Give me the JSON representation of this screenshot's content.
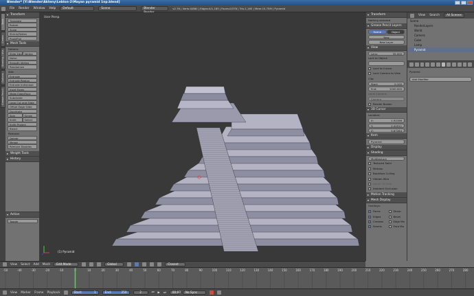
{
  "window": {
    "title": "Blender* [Y:\\Blender\\Akteny\\Leblon-2\\Mayan pyramid 1np.blend]"
  },
  "menubar": {
    "items": [
      "File",
      "Render",
      "Window",
      "Help"
    ],
    "layout": "Default",
    "scene": "Scene",
    "engine": "Blender Render",
    "stats": "v2.76 | Verts:0/880 | Edges:0/1,185 | Faces:0/378 | Tris:1,165 | Mem:15.75M | Pyramid"
  },
  "vtabs": [
    "Tools",
    "Create",
    "Shading / UVs",
    "Options",
    "Grease Pencil"
  ],
  "toolshelf": {
    "transform": {
      "title": "Transform",
      "buttons": [
        "Translate",
        "Rotate",
        "Scale",
        "Shrink/Fatten",
        "Push/Pull"
      ]
    },
    "mesh_tools": {
      "title": "Mesh Tools",
      "deform_label": "Deform:",
      "slide_edge": "Slide Edge",
      "vertex": "Vertex",
      "deform_buttons": [
        "Noise",
        "Smooth Vertex",
        "Randomize"
      ],
      "add_label": "Add:",
      "extrude": "Extrude",
      "add_buttons": [
        "Extrude Region",
        "Extrude Individual",
        "Inset Faces",
        "Make Edge/Face",
        "Subdivide",
        "Loop Cut and Slide",
        "Offset Edge Slide",
        "Duplicate"
      ],
      "spin": "Spin",
      "screw": "Screw",
      "knife": "Knife",
      "select": "Select",
      "add_buttons2": [
        "Knife Project",
        "Bisect"
      ],
      "remove_label": "Remove:",
      "delete": "Delete",
      "merge": "Merge",
      "remove_doubles": "Remove Doubles"
    },
    "weight_tools": "Weight Tools",
    "history": "History",
    "action": {
      "label": "Action",
      "value": "Toggle"
    }
  },
  "viewport": {
    "view_label": "User Persp",
    "object_label": "(1) Pyramid"
  },
  "npanel": {
    "transform_title": "Transform",
    "nothing_selected": "Nothing selected",
    "grease_pencil_title": "Grease Pencil Layers",
    "scene_btn": "Scene",
    "object_btn": "Object",
    "new_btn": "New",
    "new_layer_btn": "New Layer",
    "view_title": "View",
    "lens_label": "Lens:",
    "lens_value": "35.000",
    "lock_to_object": "Lock to Object:",
    "lock_to_cursor": "Lock to Cursor",
    "lock_camera": "Lock Camera to View",
    "clip_label": "Clip:",
    "clip_start_label": "Start:",
    "clip_start": "0.100",
    "clip_end_label": "End:",
    "clip_end": "1000.000",
    "local_camera": "Local Camera:",
    "camera_value": "Camera",
    "render_border": "Render Border",
    "cursor_title": "3D Cursor",
    "location_label": "Location:",
    "cursor_x": "1.92166",
    "cursor_y": "2.42511",
    "cursor_z": "5.67284",
    "item_title": "Item",
    "item_name": "Pyramid",
    "display_title": "Display",
    "shading_title": "Shading",
    "shading_mode": "Multitexture",
    "shading_options": [
      "Textured Solid",
      "Matcap",
      "Backface Culling",
      "Hidden Wire",
      "Depth Of Field",
      "Ambient Occlusion"
    ],
    "motion_tracking": "Motion Tracking",
    "mesh_display": "Mesh Display",
    "overlays_label": "Overlays:",
    "overlay_left": [
      "Faces",
      "Edges",
      "Creases",
      "Seams"
    ],
    "overlay_right": [
      "Sharp",
      "Bevel",
      "Edge Ma",
      "Face Ma"
    ]
  },
  "outliner": {
    "view": "View",
    "search": "Search",
    "scope": "All Scenes",
    "items": [
      "Scene",
      "RenderLayers",
      "World",
      "Camera",
      "Cube",
      "Lamp",
      "Pyramid"
    ]
  },
  "properties": {
    "object_name": "Pyramid",
    "add_modifier": "Add Modifier"
  },
  "v3header": {
    "items": [
      "View",
      "Select",
      "Add",
      "Mesh"
    ],
    "mode": "Edit Mode",
    "orientation": "Global",
    "snap": "Closest"
  },
  "timeline": {
    "ticks": [
      "-50",
      "-40",
      "-30",
      "-20",
      "-10",
      "0",
      "10",
      "20",
      "30",
      "40",
      "50",
      "60",
      "70",
      "80",
      "90",
      "100",
      "110",
      "120",
      "130",
      "140",
      "150",
      "160",
      "170",
      "180",
      "190",
      "200",
      "210",
      "220",
      "230",
      "240",
      "250",
      "260",
      "270",
      "280"
    ],
    "current_frame_marker": "0"
  },
  "tlheader": {
    "items": [
      "View",
      "Marker",
      "Frame",
      "Playback"
    ],
    "start_label": "Start:",
    "start": "1",
    "end_label": "End:",
    "end": "250",
    "current": "2",
    "time": "00:00",
    "sync": "No Sync"
  }
}
